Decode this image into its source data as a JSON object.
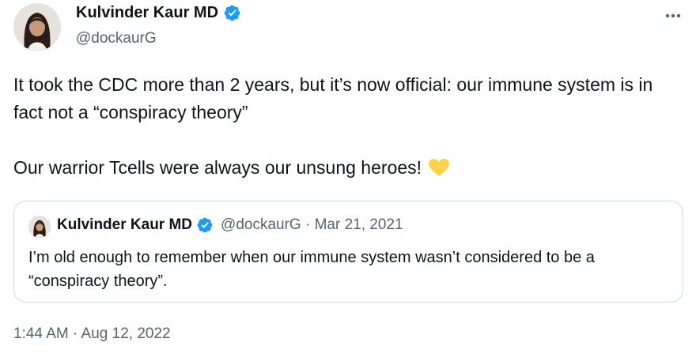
{
  "author": {
    "name": "Kulvinder Kaur MD",
    "handle": "@dockaurG",
    "verified_icon": "verified-badge-icon",
    "avatar": "avatar"
  },
  "tweet": {
    "line1": "It took the CDC more than 2 years, but it’s now official: our immune system is in fact not a “conspiracy theory”",
    "line2": "Our warrior Tcells were always our unsung heroes!",
    "emoji_icon": "yellow-heart-icon"
  },
  "quoted_tweet": {
    "name": "Kulvinder Kaur MD",
    "handle_date": "@dockaurG · Mar 21, 2021",
    "text": "I’m old enough to remember when our immune system wasn’t considered to be a “conspiracy theory”."
  },
  "timestamp": "1:44 AM · Aug 12, 2022",
  "colors": {
    "text": "#0f1419",
    "secondary": "#536471",
    "verified": "#1d9bf0",
    "border": "#cfd9de",
    "heart": "#ffd24c"
  }
}
